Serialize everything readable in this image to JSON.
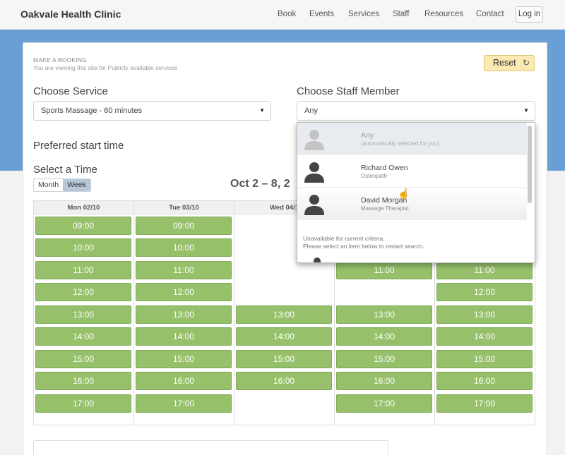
{
  "header": {
    "brand": "Oakvale Health Clinic",
    "nav": [
      {
        "label": "Book"
      },
      {
        "label": "Events"
      },
      {
        "label": "Services"
      },
      {
        "label": "Staff"
      },
      {
        "label": "Resources"
      },
      {
        "label": "Contact"
      }
    ],
    "login_label": "Log in"
  },
  "booking": {
    "heading": "MAKE A BOOKING",
    "subheading": "You are viewing this site for Publicly available services",
    "reset_label": "Reset",
    "choose_service_label": "Choose Service",
    "service_selected": "Sports Massage - 60 minutes",
    "choose_staff_label": "Choose Staff Member",
    "staff_selected": "Any",
    "preferred_start_label": "Preferred start time",
    "select_time_label": "Select a Time",
    "view_modes": [
      "Month",
      "Week"
    ],
    "active_view": "Week",
    "week_title": "Oct 2 – 8, 2"
  },
  "calendar": {
    "days": [
      {
        "label": "Mon 02/10",
        "slots": [
          "09:00",
          "10:00",
          "11:00",
          "12:00",
          "13:00",
          "14:00",
          "15:00",
          "16:00",
          "17:00"
        ]
      },
      {
        "label": "Tue 03/10",
        "slots": [
          "09:00",
          "10:00",
          "11:00",
          "12:00",
          "13:00",
          "14:00",
          "15:00",
          "16:00",
          "17:00"
        ]
      },
      {
        "label": "Wed 04/1",
        "slots": [
          "13:00",
          "14:00",
          "15:00",
          "16:00"
        ]
      },
      {
        "label": "",
        "slots": [
          "11:00",
          "13:00",
          "14:00",
          "15:00",
          "16:00",
          "17:00"
        ]
      },
      {
        "label": "",
        "slots": [
          "11:00",
          "12:00",
          "13:00",
          "14:00",
          "15:00",
          "16:00",
          "17:00"
        ]
      }
    ]
  },
  "staff_dropdown": {
    "items": [
      {
        "name": "Any",
        "role": "(automatically selected for you)"
      },
      {
        "name": "Richard Owen",
        "role": "Osteopath"
      },
      {
        "name": "David Morgan",
        "role": "Massage Therapist"
      }
    ],
    "unavailable_line1": "Unavailable for current criteria.",
    "unavailable_line2": "Please select an item below to restart search."
  },
  "colors": {
    "accent_blue": "#6a9fd6",
    "slot_green": "#96c16a",
    "reset_yellow": "#fbe9b2"
  },
  "icons": {
    "reset": "refresh-icon",
    "caret": "chevron-down-icon",
    "avatar": "person-silhouette-icon"
  }
}
